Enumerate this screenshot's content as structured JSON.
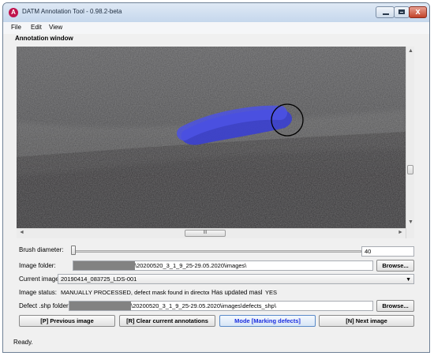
{
  "window": {
    "title": "DATM Annotation Tool - 0.98.2-beta",
    "app_icon": "A",
    "minimize_icon": "minimize-icon",
    "maximize_icon": "maximize-icon",
    "close_icon": "close-icon",
    "close_glyph": "x"
  },
  "menu": {
    "items": [
      "File",
      "Edit",
      "View"
    ]
  },
  "annotation": {
    "section_title": "Annotation window",
    "hscroll_grip": "III",
    "mask_color": "#3a3fd0"
  },
  "scroll": {
    "up": "▲",
    "down": "▼",
    "left": "◄",
    "right": "►"
  },
  "brush": {
    "label": "Brush diameter:",
    "value": "40"
  },
  "image_folder": {
    "label": "Image folder:",
    "path": "\\20200520_3_1_9_25-29.05.2020\\images\\",
    "browse": "Browse..."
  },
  "current_image": {
    "label": "Current image:",
    "value": "20190414_083725_LDS-001",
    "arrow": "▼"
  },
  "image_status": {
    "label": "Image status:",
    "value": "MANUALLY PROCESSED, defect mask found in directory",
    "mask_label": "Has updated mask?",
    "mask_value": "YES"
  },
  "defect_folder": {
    "label": "Defect .shp folder:",
    "path": "\\20200520_3_1_9_25-29.05.2020\\images\\defects_shp\\",
    "browse": "Browse..."
  },
  "buttons": {
    "previous": "[P] Previous image",
    "clear": "[R] Clear current annotations",
    "mode": "Mode [Marking defects]",
    "next": "[N] Next image"
  },
  "status_bar": {
    "text": "Ready."
  }
}
